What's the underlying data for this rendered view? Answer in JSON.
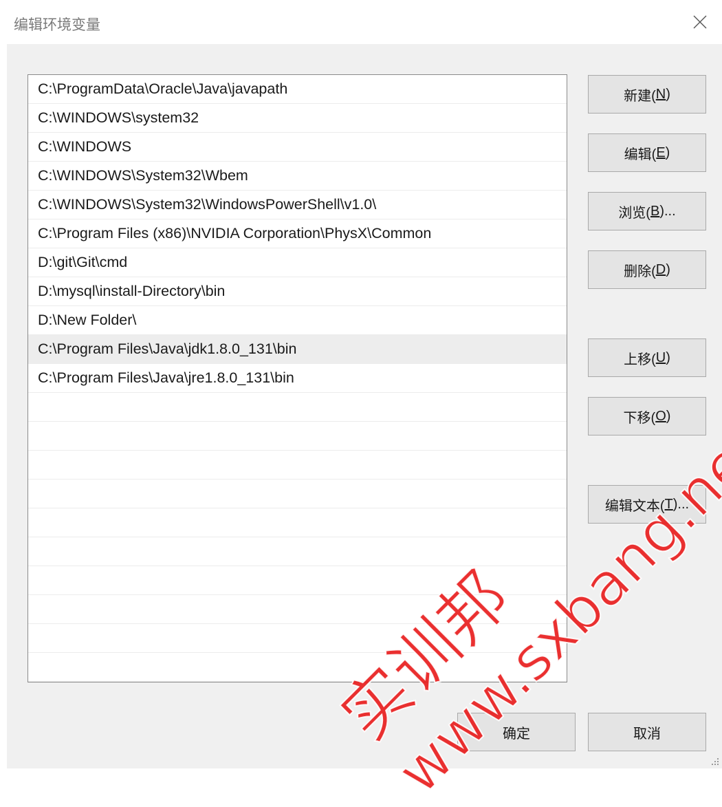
{
  "window": {
    "title": "编辑环境变量",
    "close_icon": "close-icon"
  },
  "path_list": {
    "items": [
      "C:\\ProgramData\\Oracle\\Java\\javapath",
      "C:\\WINDOWS\\system32",
      "C:\\WINDOWS",
      "C:\\WINDOWS\\System32\\Wbem",
      "C:\\WINDOWS\\System32\\WindowsPowerShell\\v1.0\\",
      "C:\\Program Files (x86)\\NVIDIA Corporation\\PhysX\\Common",
      "D:\\git\\Git\\cmd",
      "D:\\mysql\\install-Directory\\bin",
      "D:\\New Folder\\",
      "C:\\Program Files\\Java\\jdk1.8.0_131\\bin",
      "C:\\Program Files\\Java\\jre1.8.0_131\\bin"
    ],
    "selected_index": 9
  },
  "buttons": {
    "new": {
      "text": "新建(",
      "key": "N",
      "suffix": ")"
    },
    "edit": {
      "text": "编辑(",
      "key": "E",
      "suffix": ")"
    },
    "browse": {
      "text": "浏览(",
      "key": "B",
      "suffix": ")..."
    },
    "delete": {
      "text": "删除(",
      "key": "D",
      "suffix": ")"
    },
    "move_up": {
      "text": "上移(",
      "key": "U",
      "suffix": ")"
    },
    "move_down": {
      "text": "下移(",
      "key": "O",
      "suffix": ")"
    },
    "edit_text": {
      "text": "编辑文本(",
      "key": "T",
      "suffix": ")..."
    },
    "ok": "确定",
    "cancel": "取消"
  },
  "watermark": {
    "cn": "实训邦",
    "url": "www.sxbang.net"
  },
  "colors": {
    "watermark": "#e81e1e",
    "selected_row": "#ededed",
    "button_face": "#e4e4e4"
  }
}
